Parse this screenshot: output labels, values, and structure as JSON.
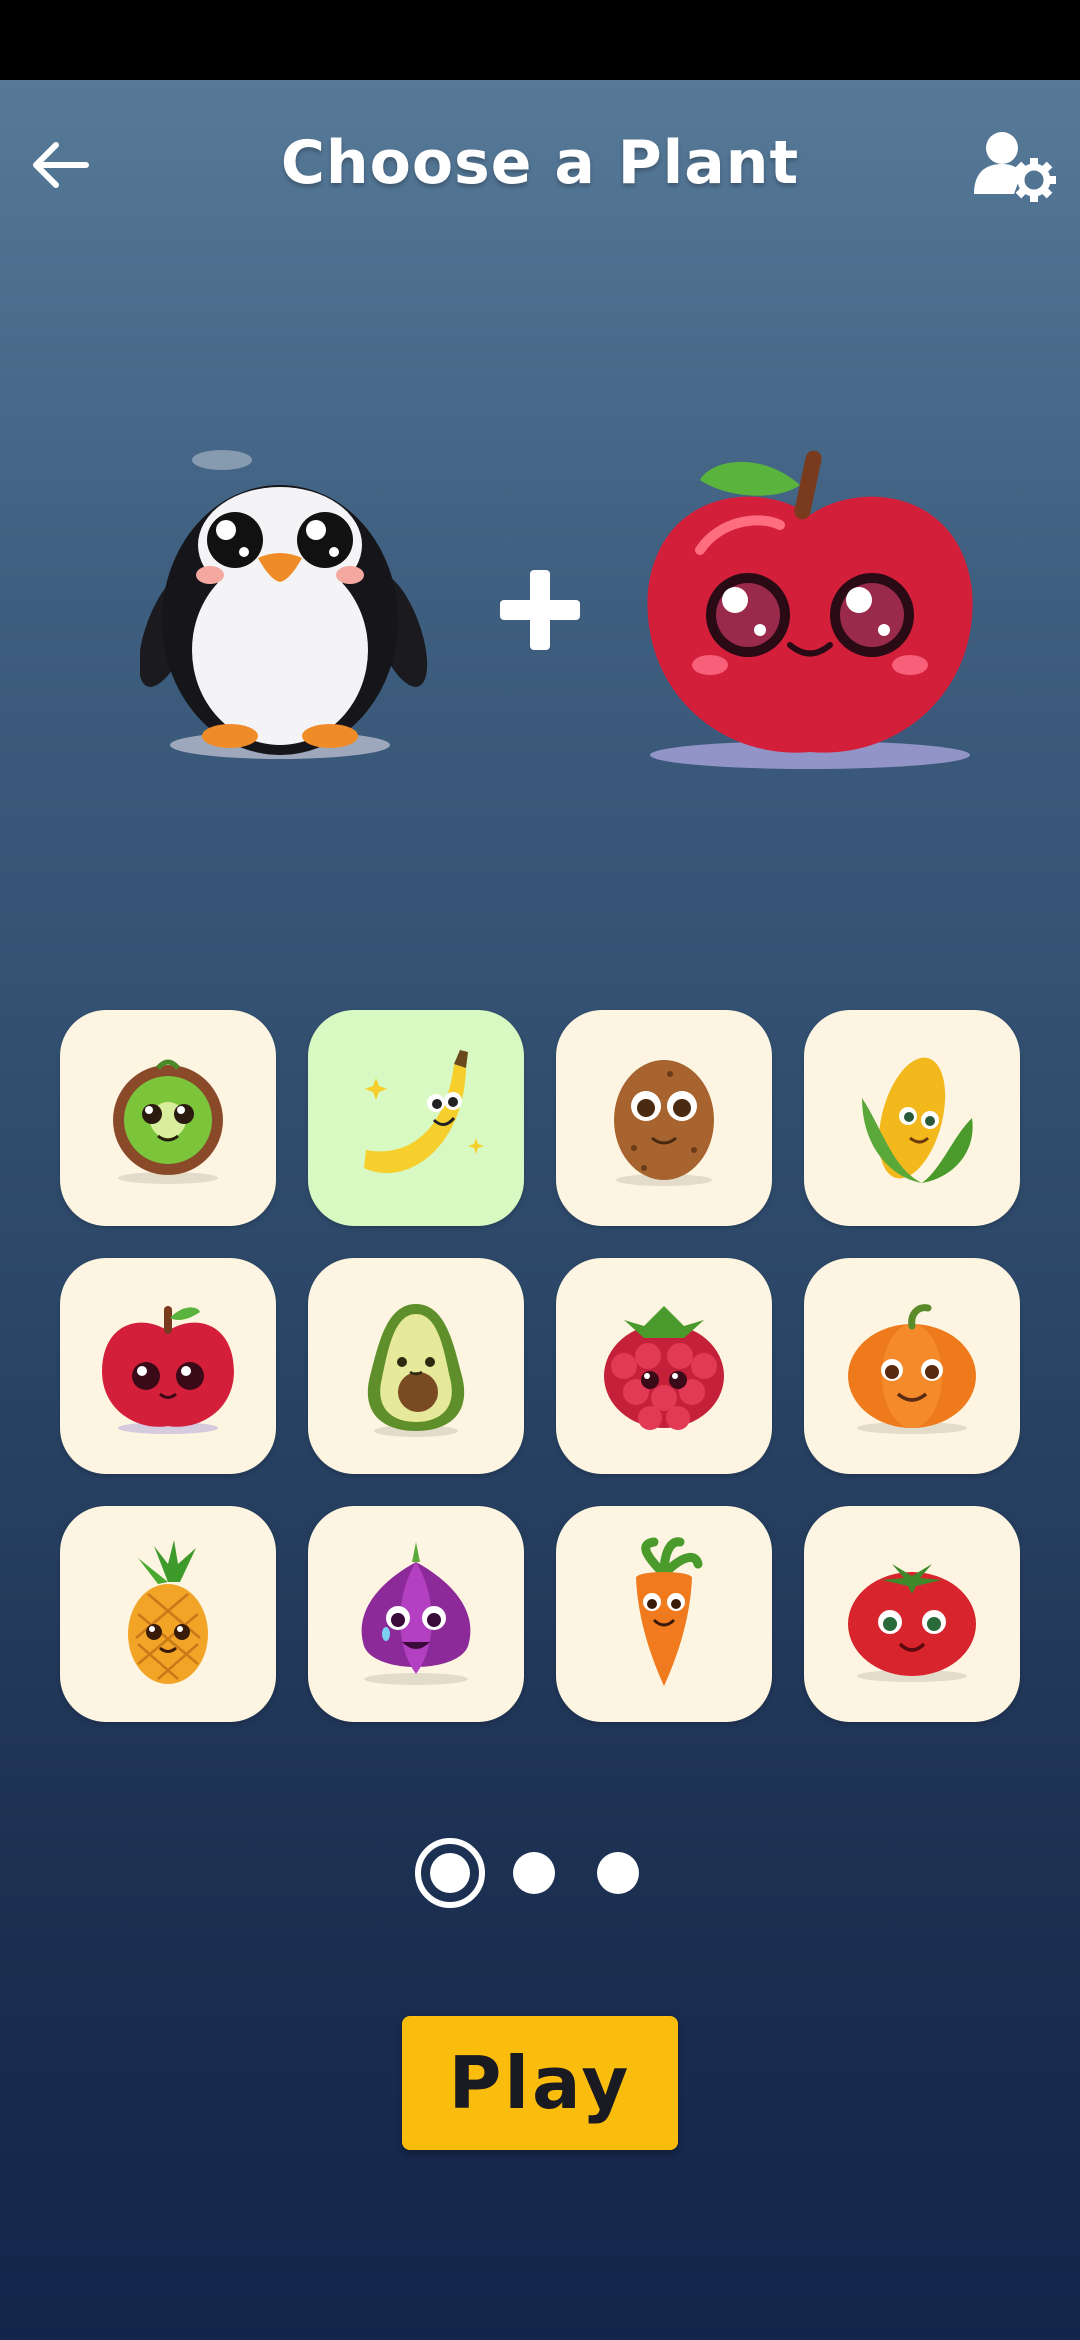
{
  "header": {
    "title": "Choose a Plant",
    "back_icon": "arrow-left-icon",
    "settings_icon": "user-settings-icon"
  },
  "combo": {
    "left": "penguin",
    "operator": "+",
    "right": "apple"
  },
  "plants": [
    {
      "name": "kiwi",
      "selected": false
    },
    {
      "name": "banana",
      "selected": true
    },
    {
      "name": "potato",
      "selected": false
    },
    {
      "name": "corn",
      "selected": false
    },
    {
      "name": "apple",
      "selected": false
    },
    {
      "name": "avocado",
      "selected": false
    },
    {
      "name": "raspberry",
      "selected": false
    },
    {
      "name": "pumpkin",
      "selected": false
    },
    {
      "name": "pineapple",
      "selected": false
    },
    {
      "name": "onion",
      "selected": false
    },
    {
      "name": "carrot",
      "selected": false
    },
    {
      "name": "tomato",
      "selected": false
    }
  ],
  "pager": {
    "current_page": 1,
    "total_pages": 3
  },
  "play_button": {
    "label": "Play"
  },
  "colors": {
    "accent": "#fbbd0d",
    "tile_bg": "#fdf5e2",
    "tile_selected_bg": "#d8f9c2",
    "bg_top": "#5a7e9c",
    "bg_bottom": "#13254a"
  }
}
